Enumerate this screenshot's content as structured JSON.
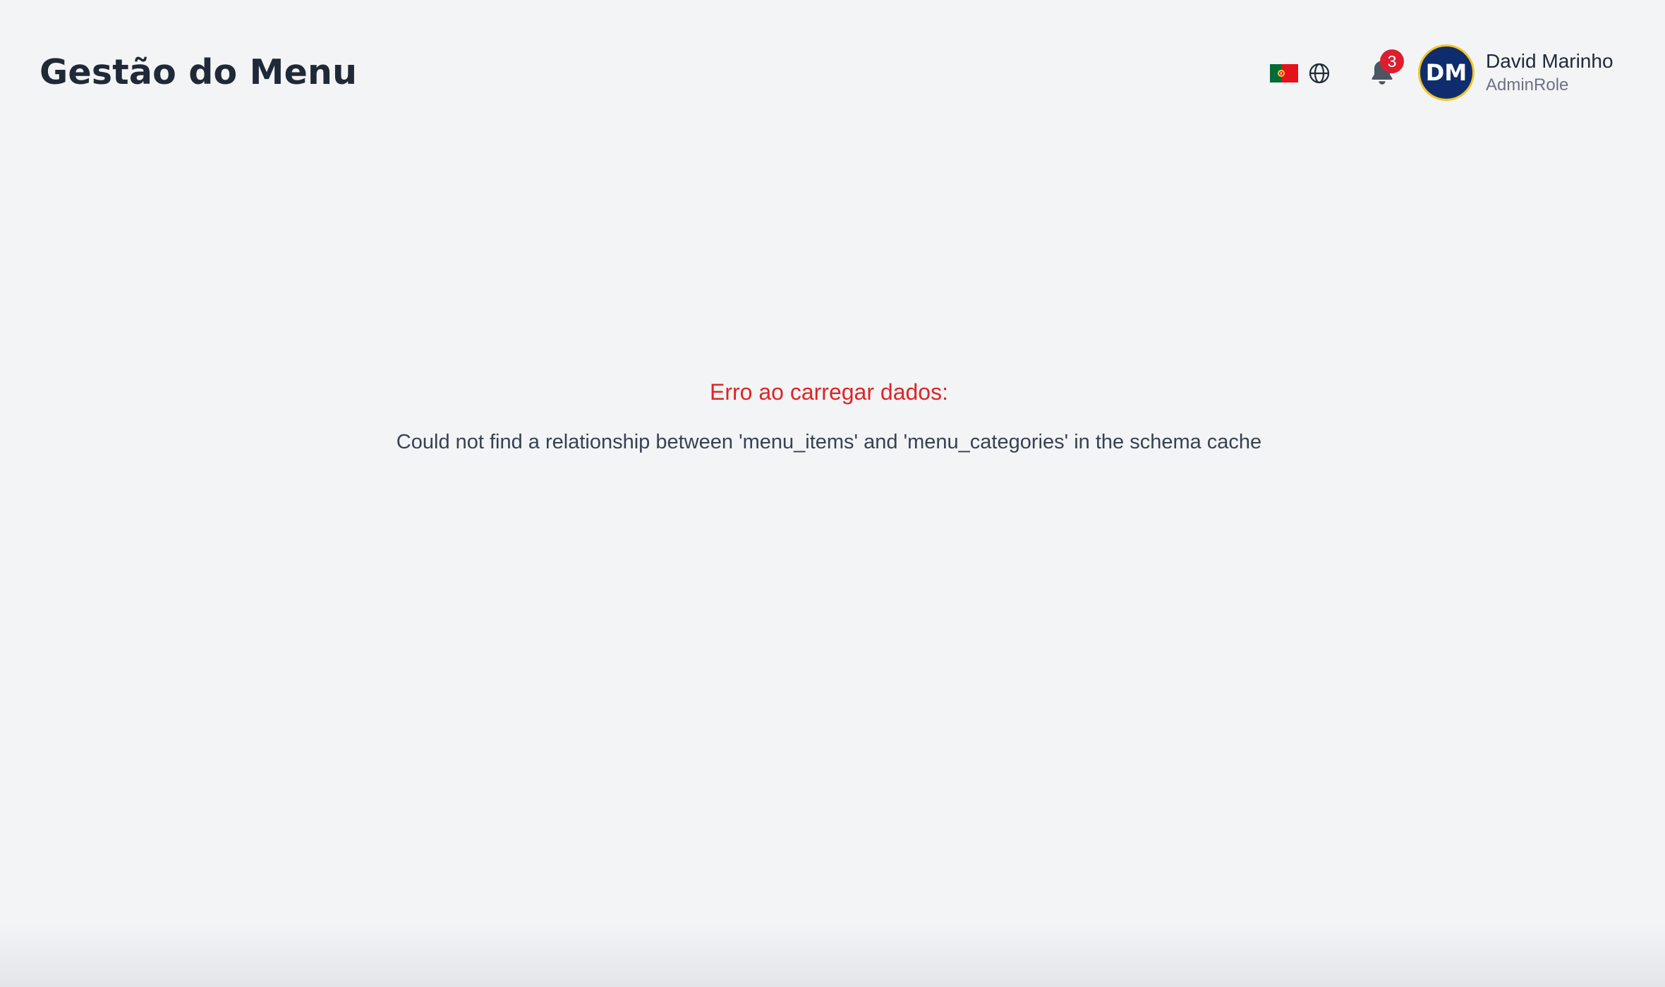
{
  "header": {
    "title": "Gestão do Menu",
    "language": {
      "flag_icon": "portugal-flag-icon",
      "globe_icon": "globe-icon"
    },
    "notifications": {
      "icon": "bell-icon",
      "count": "3"
    },
    "user": {
      "initials": "DM",
      "name": "David Marinho",
      "role": "AdminRole"
    }
  },
  "main": {
    "error_title": "Erro ao carregar dados:",
    "error_message": "Could not find a relationship between 'menu_items' and 'menu_categories' in the schema cache"
  },
  "colors": {
    "background": "#f3f4f6",
    "title_text": "#1f2937",
    "error_red": "#dc2626",
    "badge_red": "#dc1f2e",
    "avatar_bg": "#0f2d6e",
    "avatar_ring": "#f3c623",
    "muted_text": "#6b7280"
  }
}
